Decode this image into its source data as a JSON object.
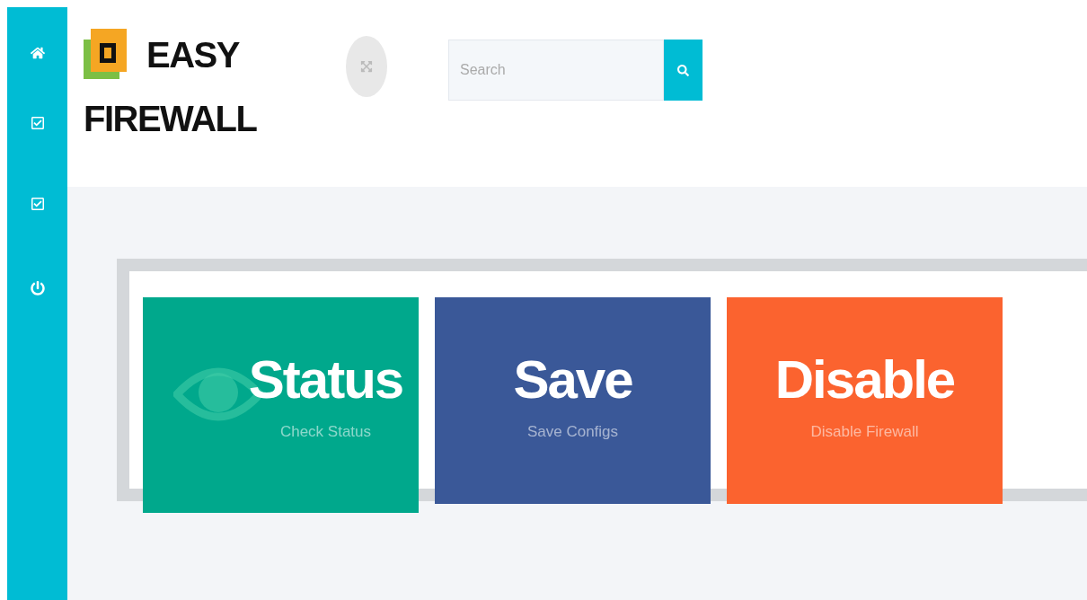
{
  "sidebar": {
    "items": [
      {
        "kind": "home"
      },
      {
        "kind": "check"
      },
      {
        "kind": "check"
      },
      {
        "kind": "power"
      }
    ]
  },
  "header": {
    "logo": {
      "line1": "EASY",
      "line2": "FIREWALL"
    },
    "search": {
      "placeholder": "Search"
    }
  },
  "tiles": [
    {
      "title": "Status",
      "subtitle": "Check Status",
      "color": "#00a88c",
      "highlighted": true
    },
    {
      "title": "Save",
      "subtitle": "Save Configs",
      "color": "#3a5898",
      "highlighted": false
    },
    {
      "title": "Disable",
      "subtitle": "Disable Firewall",
      "color": "#fb632f",
      "highlighted": false
    }
  ]
}
